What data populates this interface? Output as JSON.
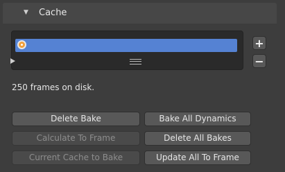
{
  "panel": {
    "title": "Cache",
    "collapse_icon": "triangle-down-icon"
  },
  "cache_list": {
    "selected_item_label": "",
    "item_icon": "point-cache-icon",
    "add_label": "+",
    "remove_label": "−"
  },
  "info": {
    "frames_text": "250 frames on disk."
  },
  "buttons": {
    "delete_bake": "Delete Bake",
    "calculate_to_frame": "Calculate To Frame",
    "current_cache_to_bake": "Current Cache to Bake",
    "bake_all_dynamics": "Bake All Dynamics",
    "delete_all_bakes": "Delete All Bakes",
    "update_all_to_frame": "Update All To Frame"
  },
  "colors": {
    "background": "#3d3d3d",
    "selection": "#5582d3",
    "accent_orange": "#f29f3a"
  }
}
